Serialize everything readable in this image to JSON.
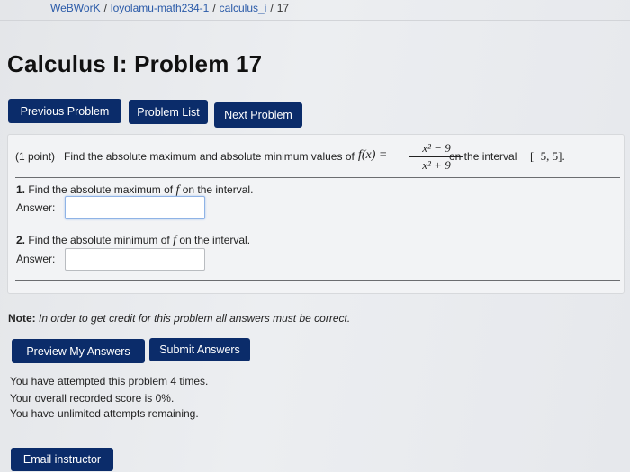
{
  "breadcrumb": {
    "root": "WeBWorK",
    "course": "loyolamu-math234-1",
    "set": "calculus_i",
    "problem": "17"
  },
  "page_title": "Calculus I: Problem 17",
  "nav": {
    "previous": "Previous Problem",
    "list": "Problem List",
    "next": "Next Problem"
  },
  "problem": {
    "points": "(1 point)",
    "statement_before": "Find the absolute maximum and absolute minimum values of",
    "function_lhs": "f(x) =",
    "numerator": "x² − 9",
    "denominator": "x² + 9",
    "statement_after": "on the interval",
    "interval": "[−5, 5].",
    "parts": [
      {
        "number": "1.",
        "text_before": "Find the absolute maximum of",
        "symbol": "f",
        "text_after": "on the interval.",
        "answer_label": "Answer:",
        "value": ""
      },
      {
        "number": "2.",
        "text_before": "Find the absolute minimum of",
        "symbol": "f",
        "text_after": "on the interval.",
        "answer_label": "Answer:",
        "value": ""
      }
    ]
  },
  "note": {
    "label": "Note:",
    "text": "In order to get credit for this problem all answers must be correct."
  },
  "actions": {
    "preview": "Preview My Answers",
    "submit": "Submit Answers"
  },
  "status": {
    "attempts": "You have attempted this problem 4 times.",
    "score": "Your overall recorded score is 0%.",
    "remaining": "You have unlimited attempts remaining."
  },
  "email": "Email instructor",
  "colors": {
    "button_bg": "#0b2c6a",
    "button_text": "#ffffff"
  }
}
